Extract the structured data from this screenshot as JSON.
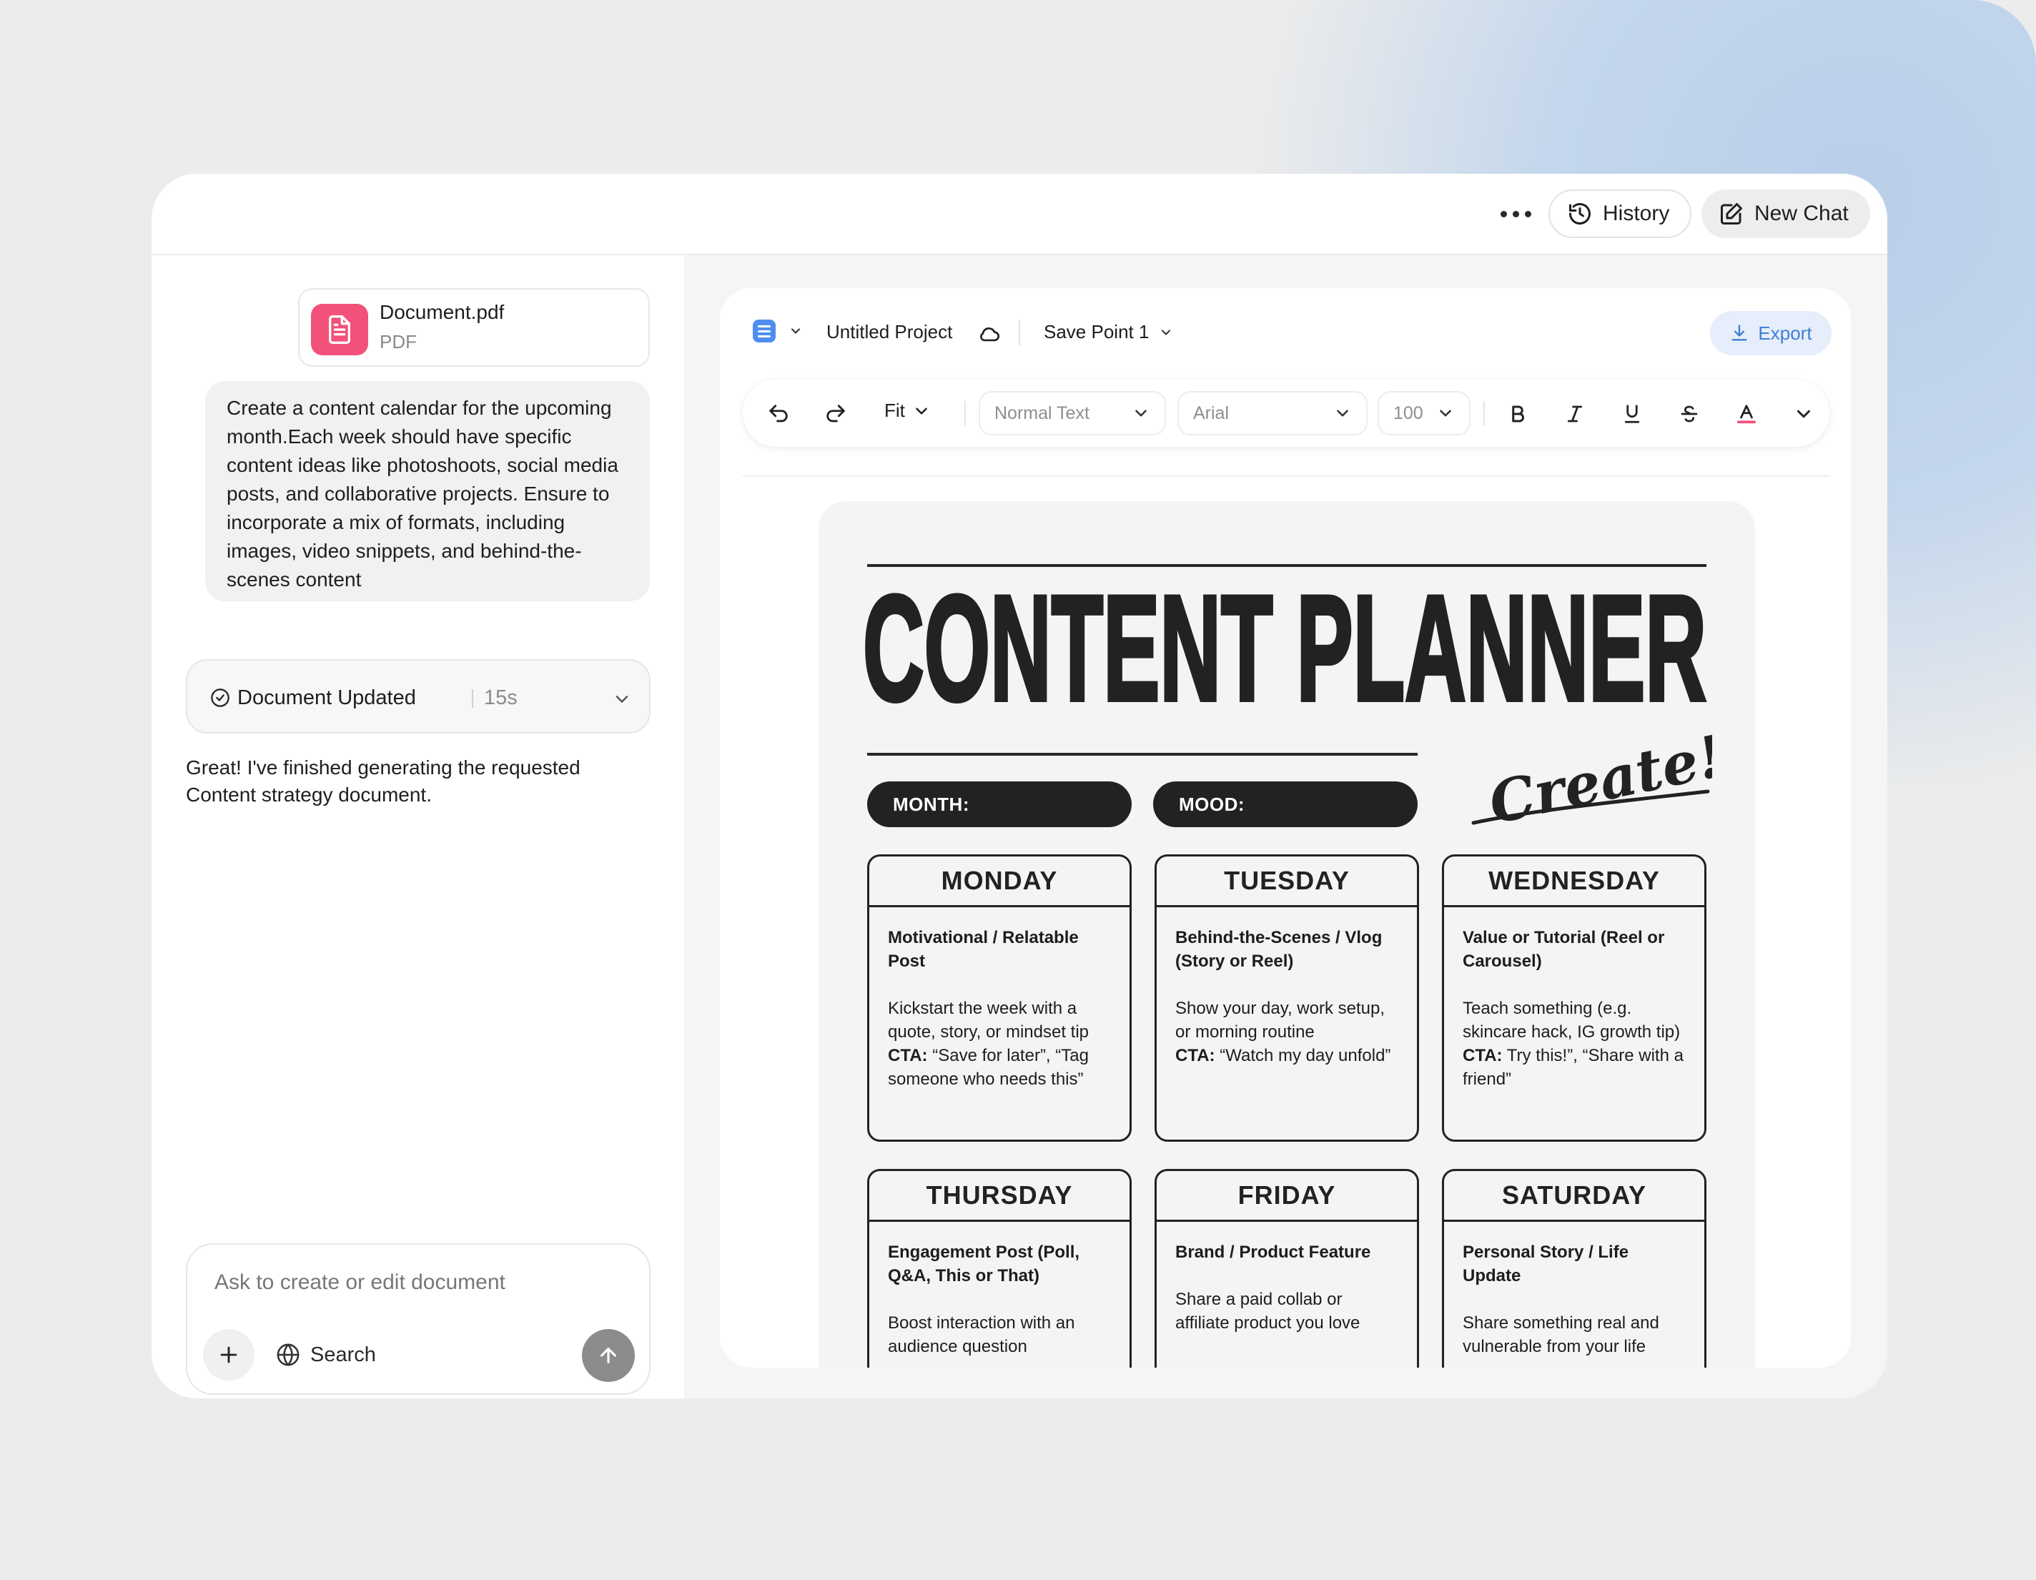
{
  "topbar": {
    "history_label": "History",
    "new_chat_label": "New Chat"
  },
  "attachment": {
    "name": "Document.pdf",
    "type": "PDF"
  },
  "prompt": "Create a content calendar for the upcoming month.Each week should have specific content ideas like photoshoots, social media posts, and collaborative projects. Ensure to incorporate a mix of formats, including images, video snippets, and behind-the-scenes content",
  "status": {
    "label": "Document Updated",
    "time": "15s"
  },
  "reply": "Great! I've finished generating the requested Content strategy document.",
  "chat_input": {
    "placeholder": "Ask to create or edit document",
    "search_label": "Search"
  },
  "editor": {
    "project_name": "Untitled Project",
    "save_point": "Save Point 1",
    "export_label": "Export",
    "zoom": "Fit",
    "text_style": "Normal Text",
    "font": "Arial",
    "font_size": "100"
  },
  "planner": {
    "title": "CONTENT PLANNER",
    "script": "Create!",
    "month_label": "MONTH:",
    "mood_label": "MOOD:",
    "cta_label": "CTA:",
    "days": [
      {
        "day": "MONDAY",
        "title": "Motivational / Relatable Post",
        "desc": "Kickstart the week with a quote, story, or mindset tip",
        "cta": " “Save for later”, “Tag someone who needs this”"
      },
      {
        "day": "TUESDAY",
        "title": "Behind-the-Scenes / Vlog (Story or Reel)",
        "desc": "Show your day, work setup, or morning routine",
        "cta": " “Watch my day unfold”"
      },
      {
        "day": "WEDNESDAY",
        "title": "Value or Tutorial (Reel or Carousel)",
        "desc": "Teach something (e.g. skincare hack, IG growth tip)",
        "cta": " Try this!”, “Share with a friend”"
      },
      {
        "day": "THURSDAY",
        "title": "Engagement Post (Poll, Q&A, This or That)",
        "desc": "Boost interaction with an audience question",
        "cta": ""
      },
      {
        "day": "FRIDAY",
        "title": "Brand / Product Feature",
        "desc": "Share a paid collab or affiliate product you love",
        "cta": ""
      },
      {
        "day": "SATURDAY",
        "title": "Personal Story / Life Update",
        "desc": "Share something real and vulnerable from your life",
        "cta": ""
      }
    ]
  },
  "colors": {
    "accent_blue": "#4f8ef0",
    "export_bg": "#e5eefa",
    "pdf_pink": "#f2517a",
    "planner_dark": "#222222"
  }
}
